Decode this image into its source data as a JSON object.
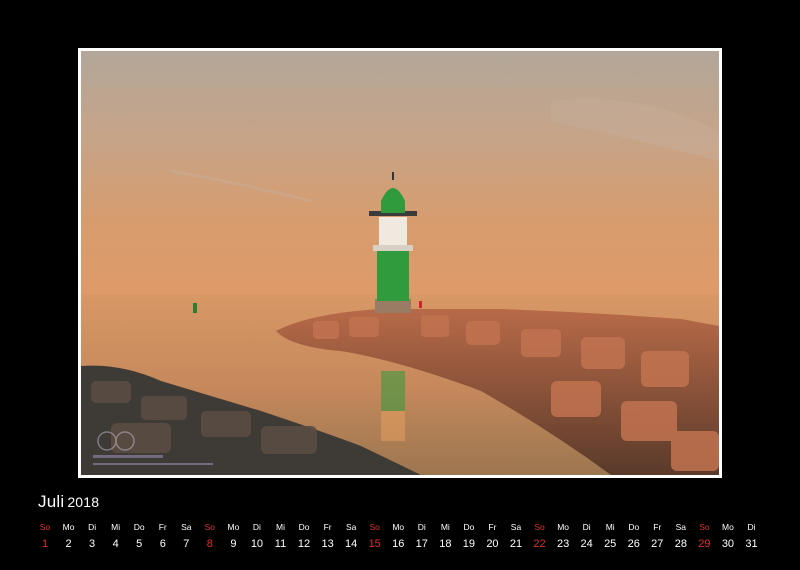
{
  "calendar": {
    "month": "Juli",
    "year": "2018",
    "days": [
      {
        "wd": "So",
        "d": "1",
        "sunday": true
      },
      {
        "wd": "Mo",
        "d": "2"
      },
      {
        "wd": "Di",
        "d": "3"
      },
      {
        "wd": "Mi",
        "d": "4"
      },
      {
        "wd": "Do",
        "d": "5"
      },
      {
        "wd": "Fr",
        "d": "6"
      },
      {
        "wd": "Sa",
        "d": "7"
      },
      {
        "wd": "So",
        "d": "8",
        "sunday": true
      },
      {
        "wd": "Mo",
        "d": "9"
      },
      {
        "wd": "Di",
        "d": "10"
      },
      {
        "wd": "Mi",
        "d": "11"
      },
      {
        "wd": "Do",
        "d": "12"
      },
      {
        "wd": "Fr",
        "d": "13"
      },
      {
        "wd": "Sa",
        "d": "14"
      },
      {
        "wd": "So",
        "d": "15",
        "sunday": true
      },
      {
        "wd": "Mo",
        "d": "16"
      },
      {
        "wd": "Di",
        "d": "17"
      },
      {
        "wd": "Mi",
        "d": "18"
      },
      {
        "wd": "Do",
        "d": "19"
      },
      {
        "wd": "Fr",
        "d": "20"
      },
      {
        "wd": "Sa",
        "d": "21"
      },
      {
        "wd": "So",
        "d": "22",
        "sunday": true
      },
      {
        "wd": "Mo",
        "d": "23"
      },
      {
        "wd": "Di",
        "d": "24"
      },
      {
        "wd": "Mi",
        "d": "25"
      },
      {
        "wd": "Do",
        "d": "26"
      },
      {
        "wd": "Fr",
        "d": "27"
      },
      {
        "wd": "Sa",
        "d": "28"
      },
      {
        "wd": "So",
        "d": "29",
        "sunday": true
      },
      {
        "wd": "Mo",
        "d": "30"
      },
      {
        "wd": "Di",
        "d": "31"
      }
    ]
  },
  "colors": {
    "page_background": "#000000",
    "frame": "#ffffff",
    "weekday_text": "#ffffff",
    "sunday_text": "#e0302a",
    "lighthouse_green": "#2f9b3c"
  },
  "photo": {
    "subject": "lighthouse-at-sunset",
    "watermark_icon": "photographer-logo-icon"
  }
}
